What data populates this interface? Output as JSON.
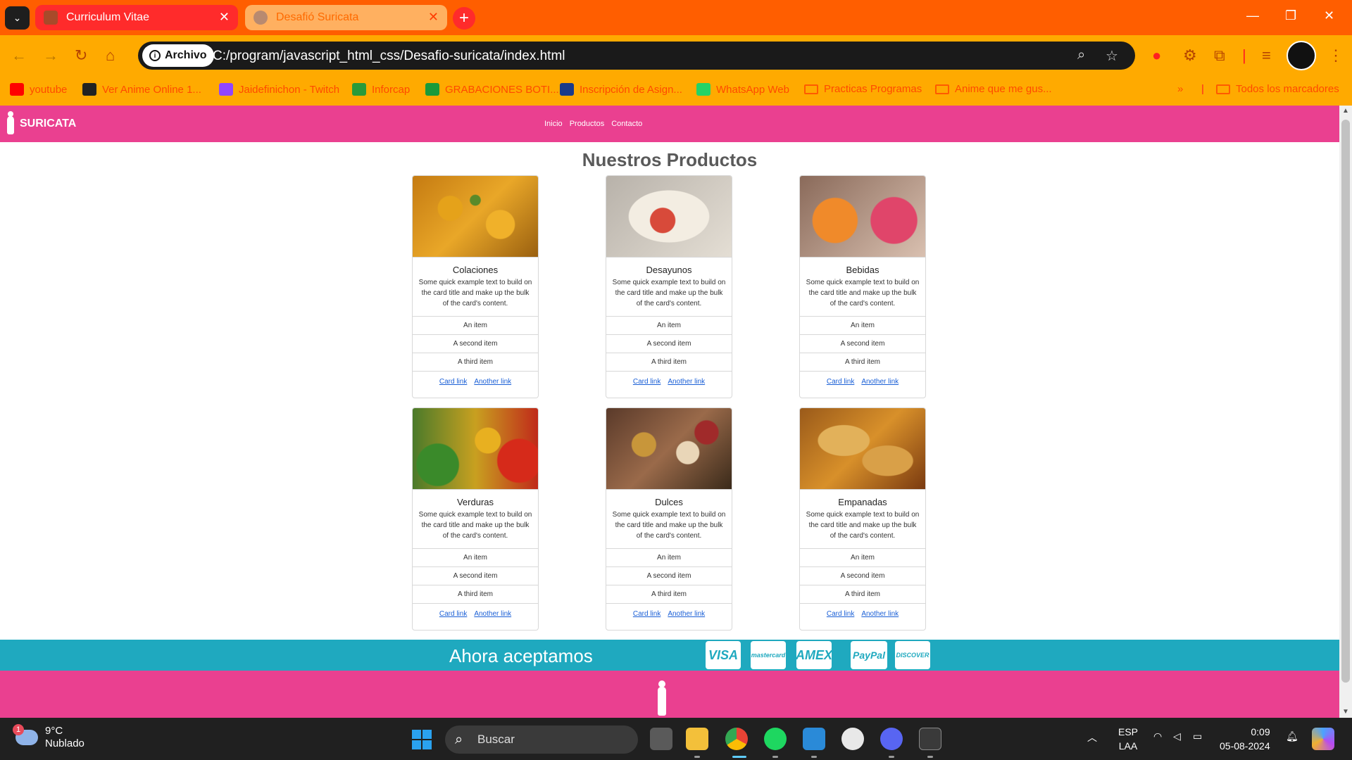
{
  "browser": {
    "tabs": [
      {
        "label": "Curriculum Vitae"
      },
      {
        "label": "Desafió Suricata"
      }
    ],
    "address": {
      "chip": "Archivo",
      "url": "C:/program/javascript_html_css/Desafio-suricata/index.html"
    },
    "bookmarks": [
      {
        "label": "youtube",
        "color": "#ff0000"
      },
      {
        "label": "Ver Anime Online 1...",
        "color": "#222222"
      },
      {
        "label": "Jaidefinichon - Twitch",
        "color": "#9146ff"
      },
      {
        "label": "Inforcap",
        "color": "#2a9a3a"
      },
      {
        "label": "GRABACIONES BOTI...",
        "color": "#1a9a3a"
      },
      {
        "label": "Inscripción de Asign...",
        "color": "#1a3a8a"
      },
      {
        "label": "WhatsApp Web",
        "color": "#25d366"
      },
      {
        "label": "Practicas Programas",
        "color": "folder"
      },
      {
        "label": "Anime que me gus...",
        "color": "folder"
      }
    ],
    "all_bookmarks": "Todos los marcadores"
  },
  "site": {
    "brand": "SURICATA",
    "nav": [
      "Inicio",
      "Productos",
      "Contacto"
    ],
    "heading": "Nuestros Productos",
    "card_text": "Some quick example text to build on the card title and make up the bulk of the card's content.",
    "card_items": [
      "An item",
      "A second item",
      "A third item"
    ],
    "card_links": [
      "Card link",
      "Another link"
    ],
    "products": [
      {
        "title": "Colaciones",
        "image": "food-chickpea-stew"
      },
      {
        "title": "Desayunos",
        "image": "food-sandwich"
      },
      {
        "title": "Bebidas",
        "image": "drinks-glasses"
      },
      {
        "title": "Verduras",
        "image": "vegetables"
      },
      {
        "title": "Dulces",
        "image": "sweets"
      },
      {
        "title": "Empanadas",
        "image": "empanadas"
      }
    ],
    "payment": {
      "text": "Ahora aceptamos",
      "cards": [
        "VISA",
        "mastercard",
        "AMEX",
        "PayPal",
        "DISCOVER"
      ]
    },
    "colors": {
      "nav": "#ea4090",
      "band": "#1fa9bf"
    }
  },
  "taskbar": {
    "weather": {
      "temp": "9°C",
      "desc": "Nublado",
      "badge": "1"
    },
    "search": "Buscar",
    "lang": {
      "line1": "ESP",
      "line2": "LAA"
    },
    "clock": {
      "time": "0:09",
      "date": "05-08-2024"
    }
  }
}
